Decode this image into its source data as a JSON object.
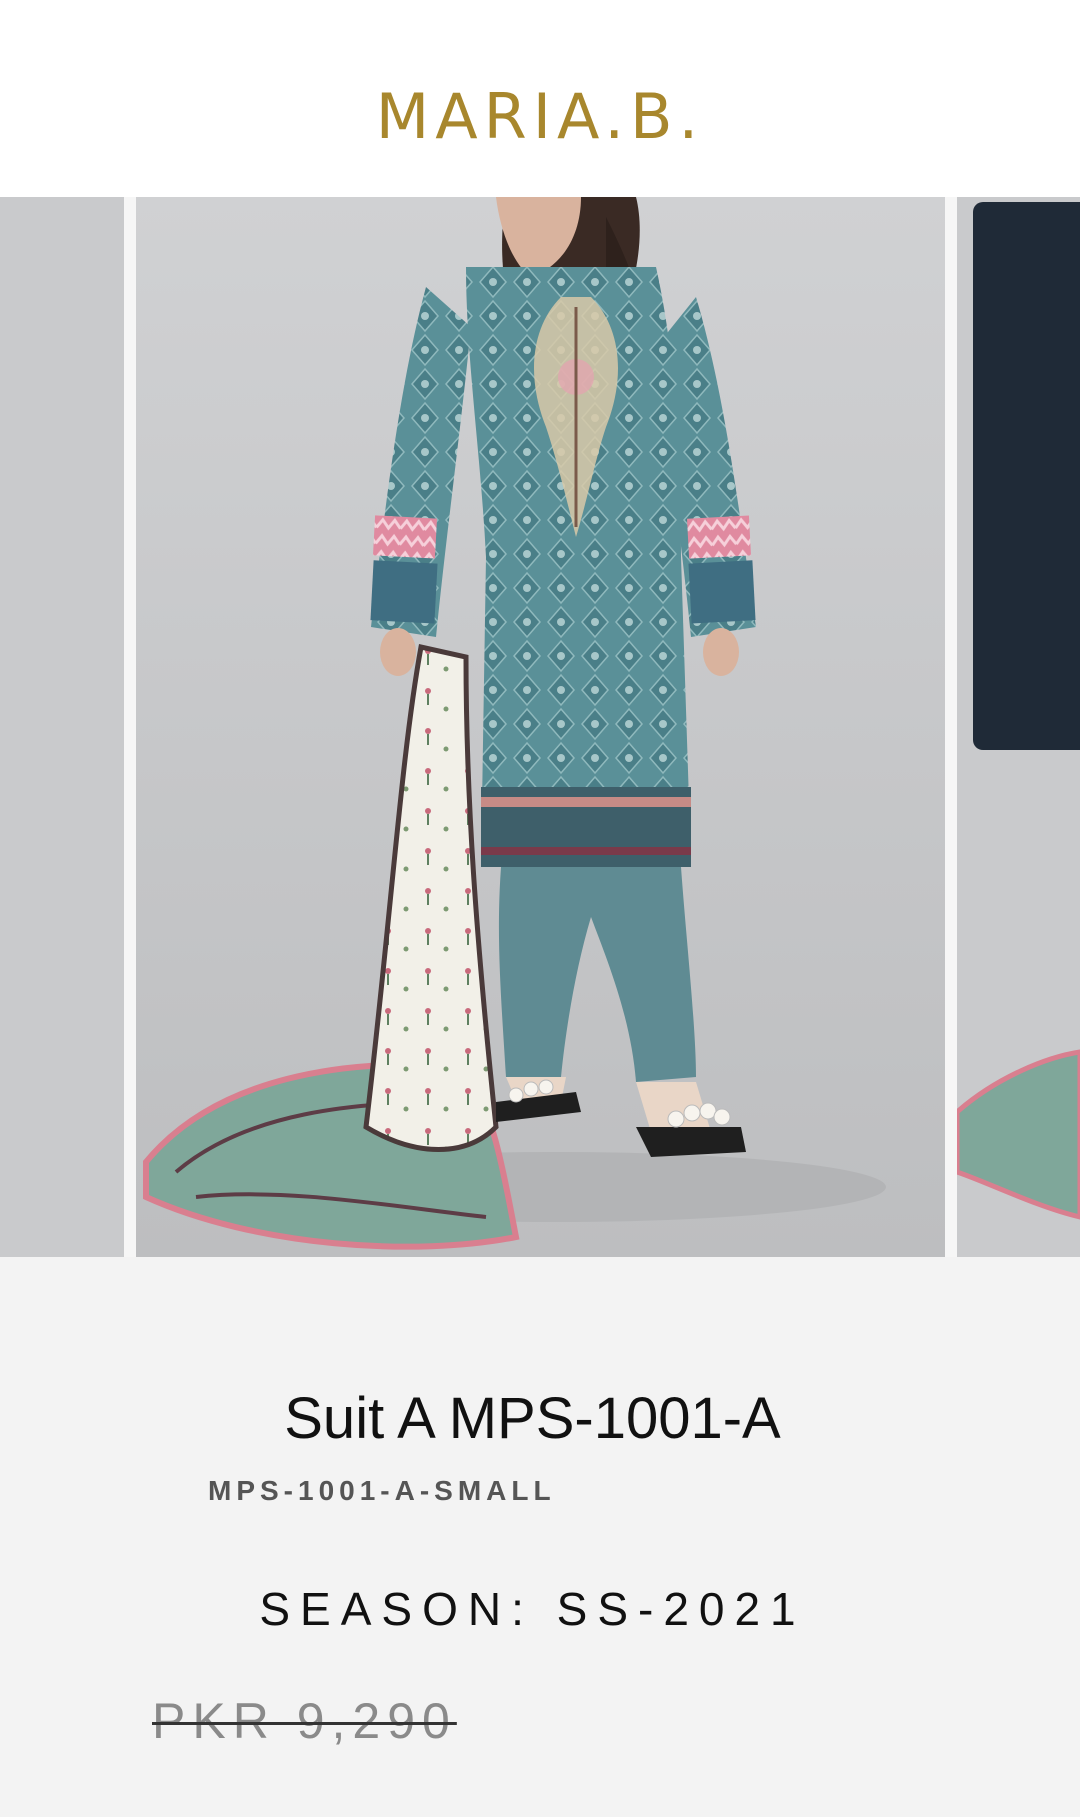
{
  "brand": {
    "logo_text": "MARIA.B."
  },
  "product": {
    "title": "Suit A MPS-1001-A",
    "sku": "MPS-1001-A-SMALL",
    "season": "SEASON: SS-2021",
    "price": "PKR 9,290"
  },
  "colors": {
    "brand_gold": "#a8872d",
    "tunic_teal": "#4f8790",
    "trouser_teal": "#5f8b93",
    "overlay_panel": "#1f2a37",
    "accent_pink": "#e08aa0"
  },
  "carousel": {
    "slides": [
      "previous-slide",
      "product-image-main",
      "next-slide"
    ]
  }
}
